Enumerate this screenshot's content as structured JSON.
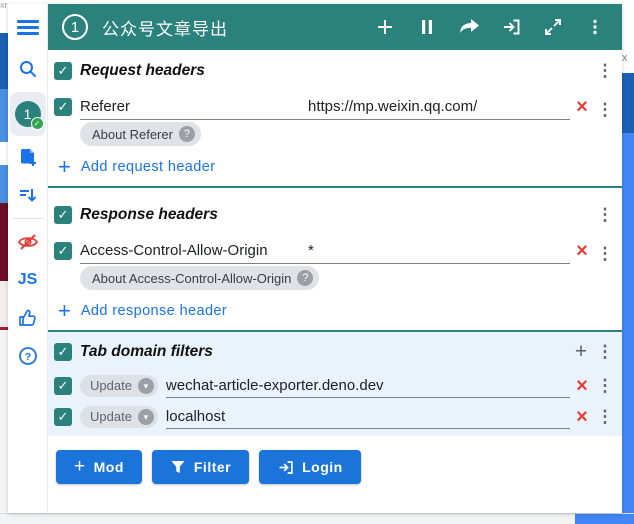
{
  "background": {
    "left_top_text": "xr",
    "right_top_text": "x"
  },
  "colors": {
    "teal": "#2b827c",
    "accent_blue": "#1a73e8",
    "button_blue": "#1b74d9",
    "danger_red": "#e33e38",
    "filter_section_bg": "#eaf2fc",
    "pill_bg": "#dfe2e6",
    "pill_icon_bg": "#9aa0a6",
    "page_blue": "#4285f4",
    "page_blue_dark": "#1a5fb4"
  },
  "glyphs": {
    "check": "✓",
    "close": "×",
    "dots": "⋮",
    "plus": "+",
    "help": "?",
    "chevron_down": "▾"
  },
  "sidebar": {
    "profile_badge": "1",
    "js_label": "JS"
  },
  "titlebar": {
    "profile_number": "1",
    "title": "公众号文章导出"
  },
  "request_headers": {
    "title": "Request headers",
    "rows": [
      {
        "name": "Referer",
        "value": "https://mp.weixin.qq.com/"
      }
    ],
    "about_label": "About Referer",
    "add_label": "Add request header"
  },
  "response_headers": {
    "title": "Response headers",
    "rows": [
      {
        "name": "Access-Control-Allow-Origin",
        "value": "*"
      }
    ],
    "about_label": "About Access-Control-Allow-Origin",
    "add_label": "Add response header"
  },
  "tab_filters": {
    "title": "Tab domain filters",
    "rows": [
      {
        "type_label": "Update",
        "value": "wechat-article-exporter.deno.dev"
      },
      {
        "type_label": "Update",
        "value": "localhost"
      }
    ]
  },
  "footer": {
    "buttons": [
      {
        "label": "Mod"
      },
      {
        "label": "Filter"
      },
      {
        "label": "Login"
      }
    ]
  }
}
